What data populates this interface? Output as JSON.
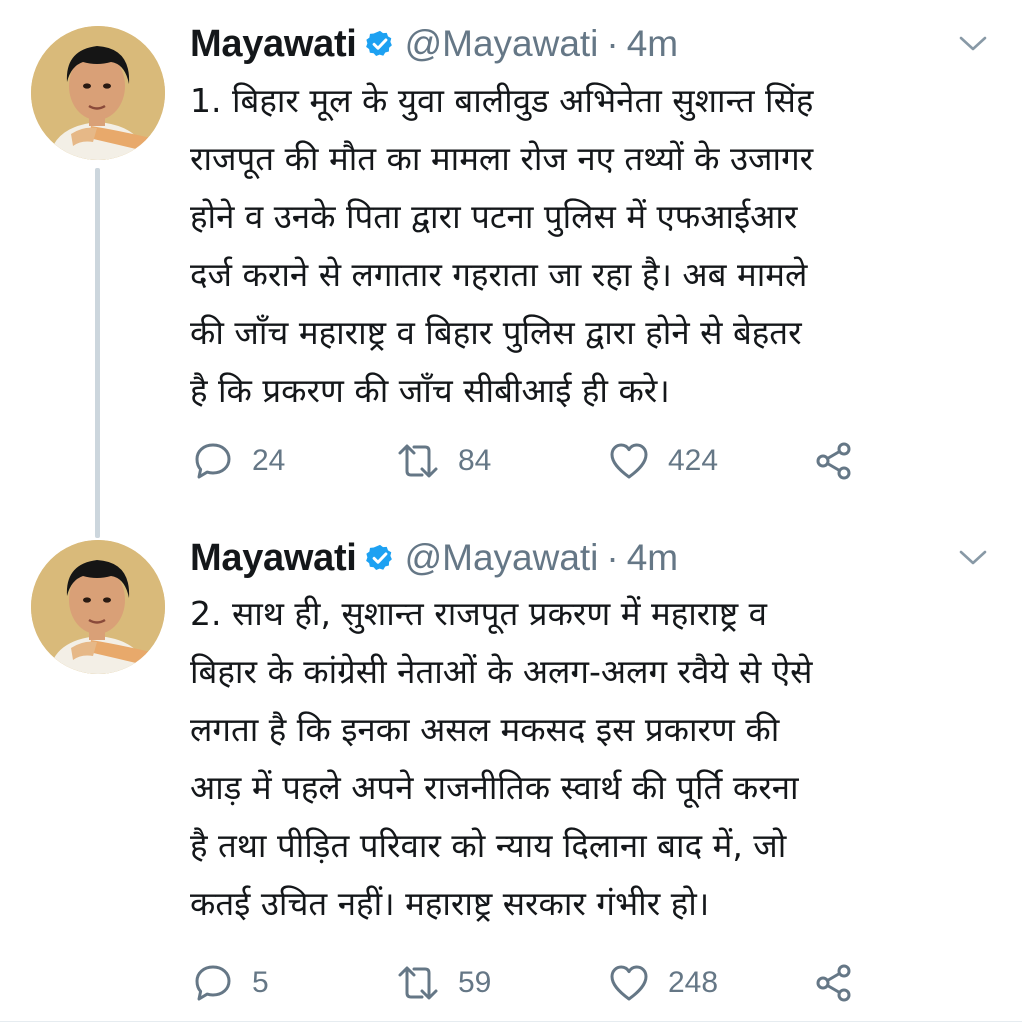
{
  "tweets": [
    {
      "name": "Mayawati",
      "handle": "@Mayawati",
      "separator": "·",
      "time": "4m",
      "text": "1. बिहार मूल के युवा बालीवुड अभिनेता सुशान्त सिंह\nराजपूत की मौत का मामला रोज नए तथ्यों के उजागर\nहोने व उनके पिता द्वारा पटना पुलिस में एफआईआर\nदर्ज कराने से लगातार गहराता जा रहा है। अब मामले\nकी जाँच महाराष्ट्र व बिहार पुलिस द्वारा होने से बेहतर\nहै कि प्रकरण की जाँच सीबीआई ही करे।",
      "replies": "24",
      "retweets": "84",
      "likes": "424"
    },
    {
      "name": "Mayawati",
      "handle": "@Mayawati",
      "separator": "·",
      "time": "4m",
      "text": "2. साथ ही, सुशान्त राजपूत प्रकरण में महाराष्ट्र व\nबिहार के कांग्रेसी नेताओं के अलग-अलग रवैये से ऐसे\nलगता है कि इनका असल मकसद इस प्रकारण की\nआड़ में पहले अपने राजनीतिक स्वार्थ की पूर्ति करना\nहै तथा पीड़ित परिवार को न्याय दिलाना बाद में, जो\nकतई उचित नहीं। महाराष्ट्र सरकार गंभीर हो।",
      "replies": "5",
      "retweets": "59",
      "likes": "248"
    }
  ],
  "icons": {
    "verified": "verified-badge-icon",
    "caret": "chevron-down-icon",
    "reply": "reply-icon",
    "retweet": "retweet-icon",
    "like": "heart-icon",
    "share": "share-icon"
  },
  "colors": {
    "text": "#14171a",
    "secondary": "#657786",
    "verified": "#1da1f2",
    "thread_line": "#ccd6dd",
    "avatar_bg": "#d9ba7a"
  }
}
